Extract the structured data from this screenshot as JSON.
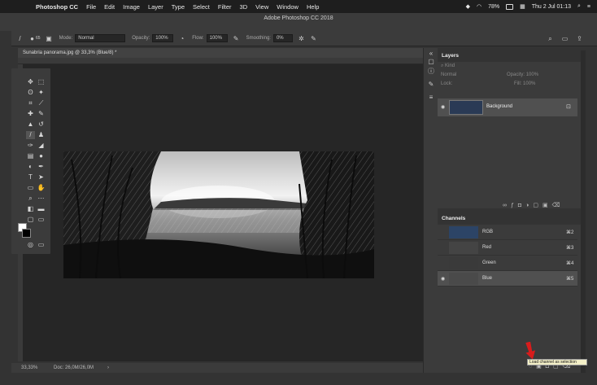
{
  "menubar": {
    "app_name": "Photoshop CC",
    "menus": [
      "File",
      "Edit",
      "Image",
      "Layer",
      "Type",
      "Select",
      "Filter",
      "3D",
      "View",
      "Window",
      "Help"
    ],
    "battery": "78%",
    "datetime": "Thu 2 Jul  01:13"
  },
  "window": {
    "title": "Adobe Photoshop CC 2018"
  },
  "options": {
    "mode_label": "Mode:",
    "mode_value": "Normal",
    "opacity_label": "Opacity:",
    "opacity_value": "100%",
    "flow_label": "Flow:",
    "flow_value": "100%",
    "smoothing_label": "Smoothing:",
    "smoothing_value": "0%",
    "brush_size": "65"
  },
  "document": {
    "tab_title": "Sunabria panorama.jpg @ 33,3% (Blue/8) *",
    "zoom": "33,33%",
    "doc_info": "Doc: 26,0M/26,0M"
  },
  "layers_panel": {
    "title": "Layers",
    "kind_label": "Kind",
    "blend_mode": "Normal",
    "opacity_label": "Opacity:",
    "opacity_value": "100%",
    "lock_label": "Lock:",
    "fill_label": "Fill:",
    "fill_value": "100%",
    "layer_name": "Background"
  },
  "channels_panel": {
    "title": "Channels",
    "channels": [
      {
        "name": "RGB",
        "shortcut": "⌘2"
      },
      {
        "name": "Red",
        "shortcut": "⌘3"
      },
      {
        "name": "Green",
        "shortcut": "⌘4"
      },
      {
        "name": "Blue",
        "shortcut": "⌘5"
      }
    ],
    "tooltip": "Load channel as selection"
  },
  "colors": {
    "accent_arrow": "#d81c1c",
    "selected_row": "#505050",
    "tooltip_bg": "#f4f0c8"
  }
}
